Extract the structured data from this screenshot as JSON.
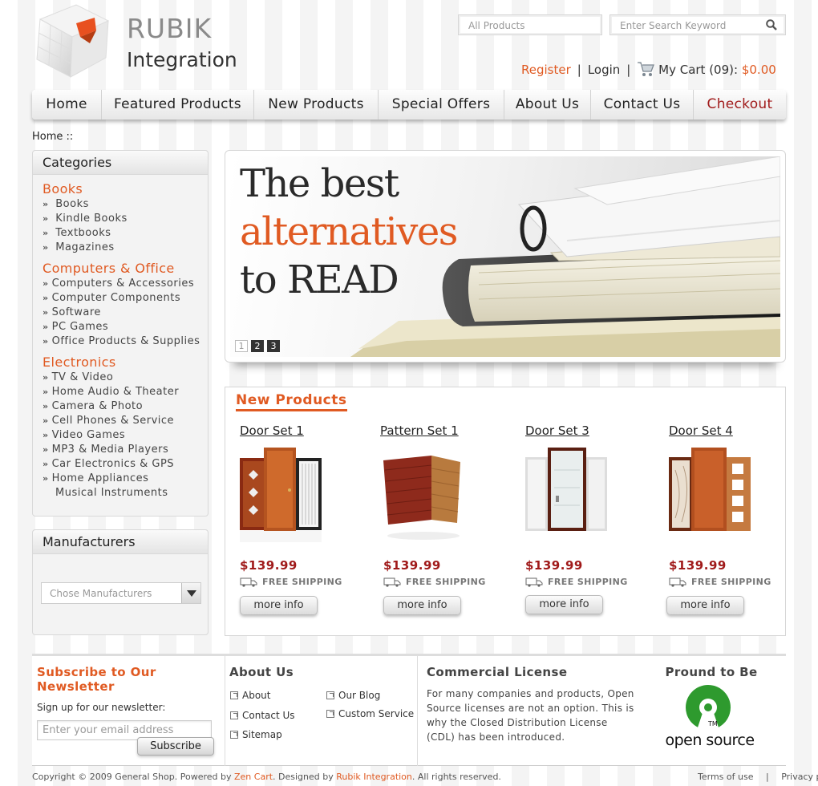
{
  "header": {
    "brand_line1": "RUBIK",
    "brand_line2": "Integration",
    "category_select": "All Products",
    "search_placeholder": "Enter Search Keyword",
    "register": "Register",
    "login": "Login",
    "cart_label": "My Cart (09):",
    "cart_total": "$0.00"
  },
  "nav": [
    "Home",
    "Featured Products",
    "New Products",
    "Special Offers",
    "About Us",
    "Contact Us",
    "Checkout"
  ],
  "breadcrumb": "Home ::",
  "categories": {
    "title": "Categories",
    "groups": [
      {
        "name": "Books",
        "items": [
          "Books",
          "Kindle Books",
          "Textbooks",
          "Magazines"
        ]
      },
      {
        "name": "Computers & Office",
        "items": [
          "Computers & Accessories",
          "Computer Components",
          "Software",
          "PC Games",
          "Office Products & Supplies"
        ]
      },
      {
        "name": "Electronics",
        "items": [
          "TV & Video",
          "Home Audio & Theater",
          "Camera & Photo",
          "Cell Phones & Service",
          "Video Games",
          "MP3 & Media Players",
          "Car Electronics & GPS",
          "Home Appliances",
          "Musical Instruments"
        ]
      }
    ]
  },
  "manufacturers": {
    "title": "Manufacturers",
    "select_placeholder": "Chose Manufacturers"
  },
  "banner": {
    "line1": "The best",
    "line2": "alternatives",
    "line3": "to READ",
    "pages": [
      "1",
      "2",
      "3"
    ],
    "active_page": "1"
  },
  "products": {
    "title": "New Products",
    "items": [
      {
        "name": "Door Set 1",
        "price": "$139.99",
        "shipping": "FREE SHIPPING",
        "button": "more info"
      },
      {
        "name": "Pattern Set 1",
        "price": "$139.99",
        "shipping": "FREE SHIPPING",
        "button": "more info"
      },
      {
        "name": "Door Set 3",
        "price": "$139.99",
        "shipping": "FREE SHIPPING",
        "button": "more info"
      },
      {
        "name": "Door Set 4",
        "price": "$139.99",
        "shipping": "FREE SHIPPING",
        "button": "more info"
      }
    ]
  },
  "footer": {
    "newsletter": {
      "title": "Subscribe to Our Newsletter",
      "text": "Sign up for our newsletter:",
      "placeholder": "Enter your email address",
      "button": "Subscribe"
    },
    "about": {
      "title": "About Us",
      "links": [
        "About",
        "Our Blog",
        "Contact Us",
        "Custom Service",
        "Sitemap"
      ]
    },
    "license": {
      "title": "Commercial License",
      "text": "For many companies and products, Open Source licenses are not an option. This is why the Closed Distribution License (CDL) has been introduced."
    },
    "proud": {
      "title": "Pround to Be",
      "logo_text": "open source",
      "tm": "TM"
    }
  },
  "copyright": {
    "prefix": "Copyright © 2009  General Shop. Powered by",
    "zen": "Zen Cart",
    "mid": ". Designed by",
    "rubik": "Rubik Integration",
    "suffix": ". All rights reserved."
  },
  "bottom_links": {
    "terms": "Terms of use",
    "separator": "|",
    "privacy": "Privacy po"
  }
}
